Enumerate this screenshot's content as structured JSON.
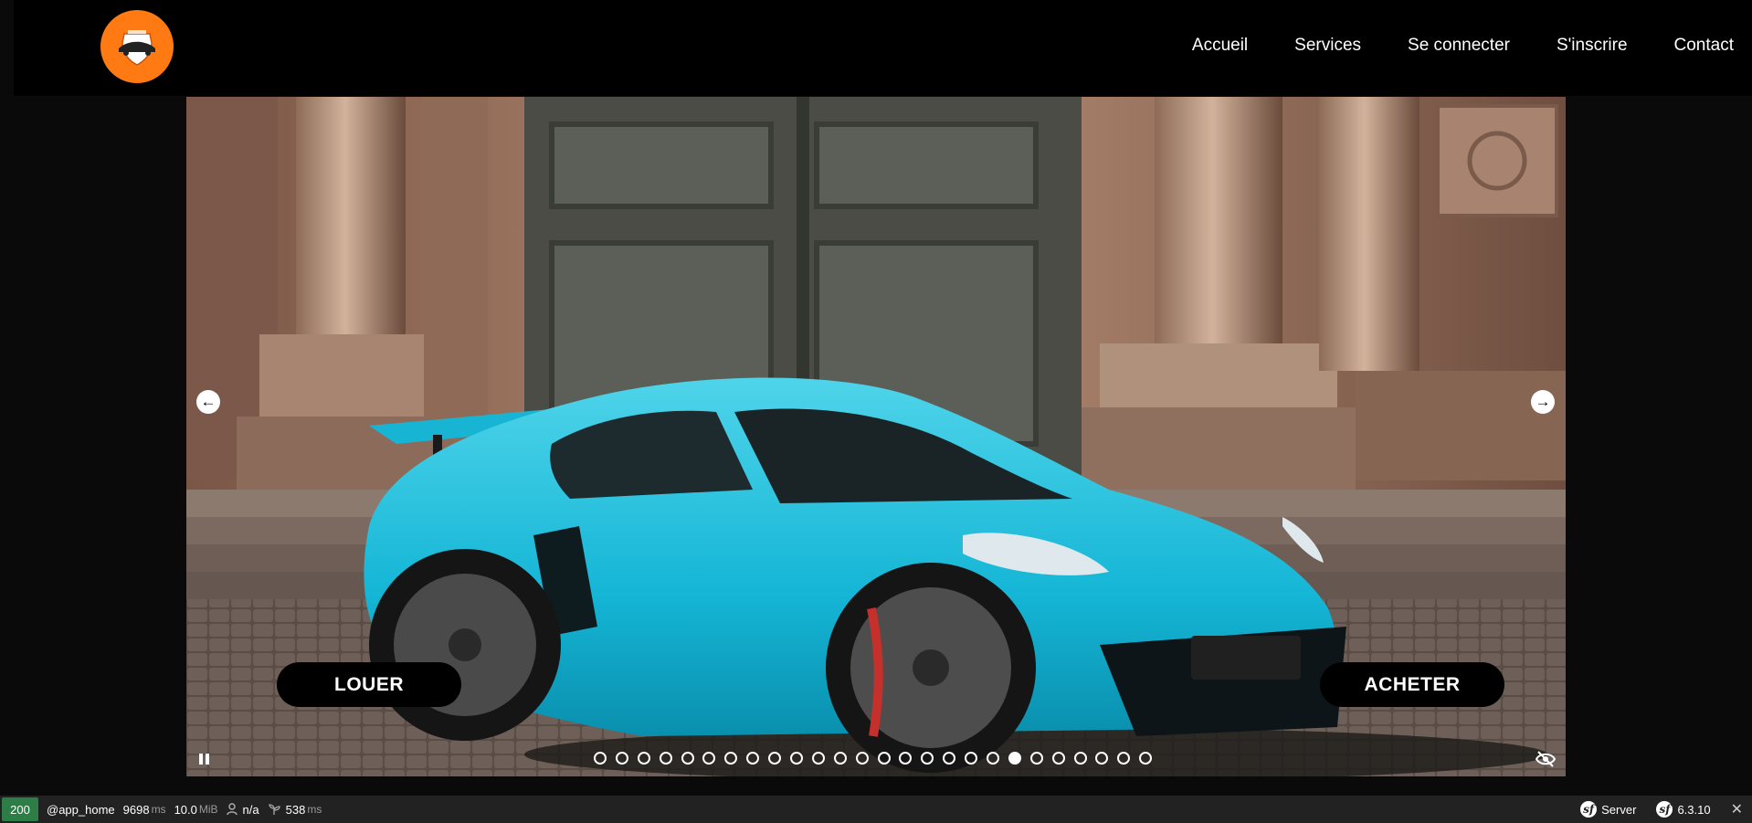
{
  "nav": {
    "items": [
      {
        "label": "Accueil"
      },
      {
        "label": "Services"
      },
      {
        "label": "Se connecter"
      },
      {
        "label": "S'inscrire"
      },
      {
        "label": "Contact"
      }
    ]
  },
  "logo": {
    "icon": "car-shield-logo",
    "color": "#ff7a12"
  },
  "carousel": {
    "prev_icon": "arrow-left-icon",
    "next_icon": "arrow-right-icon",
    "buttons": {
      "rent": "LOUER",
      "buy": "ACHETER"
    },
    "indicator_count": 26,
    "active_index": 19,
    "pause_icon": "pause-icon",
    "visibility_icon": "eye-off-icon"
  },
  "toolbar": {
    "status_code": "200",
    "route": "@app_home",
    "time_value": "9698",
    "time_unit": "ms",
    "memory_value": "10.0",
    "memory_unit": "MiB",
    "user": "n/a",
    "init_value": "538",
    "init_unit": "ms",
    "server_label": "Server",
    "version": "6.3.10"
  }
}
